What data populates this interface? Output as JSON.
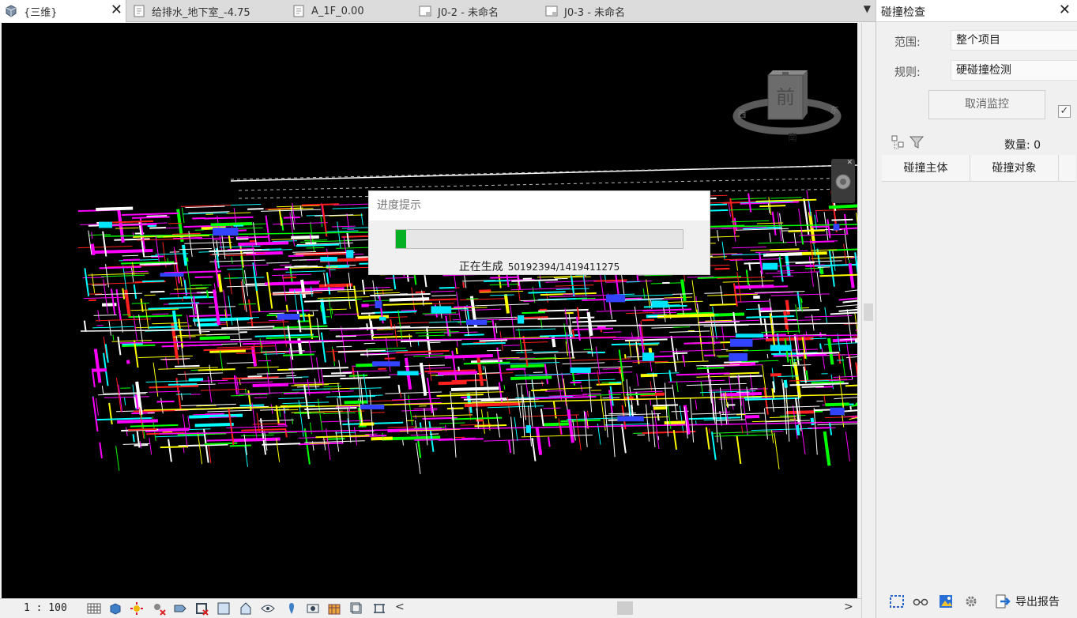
{
  "tabs": [
    {
      "label": "{三维}",
      "active": true,
      "icon": "3d-cube-icon"
    },
    {
      "label": "给排水_地下室_-4.75",
      "active": false,
      "icon": "floor-plan-icon"
    },
    {
      "label": "A_1F_0.00",
      "active": false,
      "icon": "floor-plan-icon"
    },
    {
      "label": "J0-2 - 未命名",
      "active": false,
      "icon": "sheet-icon"
    },
    {
      "label": "J0-3 - 未命名",
      "active": false,
      "icon": "sheet-icon"
    }
  ],
  "viewcube": {
    "face": "前",
    "west": "西",
    "east": "东",
    "south": "南"
  },
  "progress_dialog": {
    "title": "进度提示",
    "status": "正在生成",
    "count": "50192394/1419411275",
    "fraction": 0.0354
  },
  "statusbar": {
    "scale": "1 : 100"
  },
  "panel": {
    "title": "碰撞检查",
    "scope_label": "范围:",
    "scope_value": "整个项目",
    "rule_label": "规则:",
    "rule_value": "硬碰撞检测",
    "cancel_button": "取消监控",
    "count_label": "数量: 0",
    "columns": [
      "碰撞主体",
      "碰撞对象"
    ],
    "export_label": "导出报告"
  },
  "colors": {
    "progress_fill": "#06b025",
    "viewport_bg": "#000000"
  }
}
